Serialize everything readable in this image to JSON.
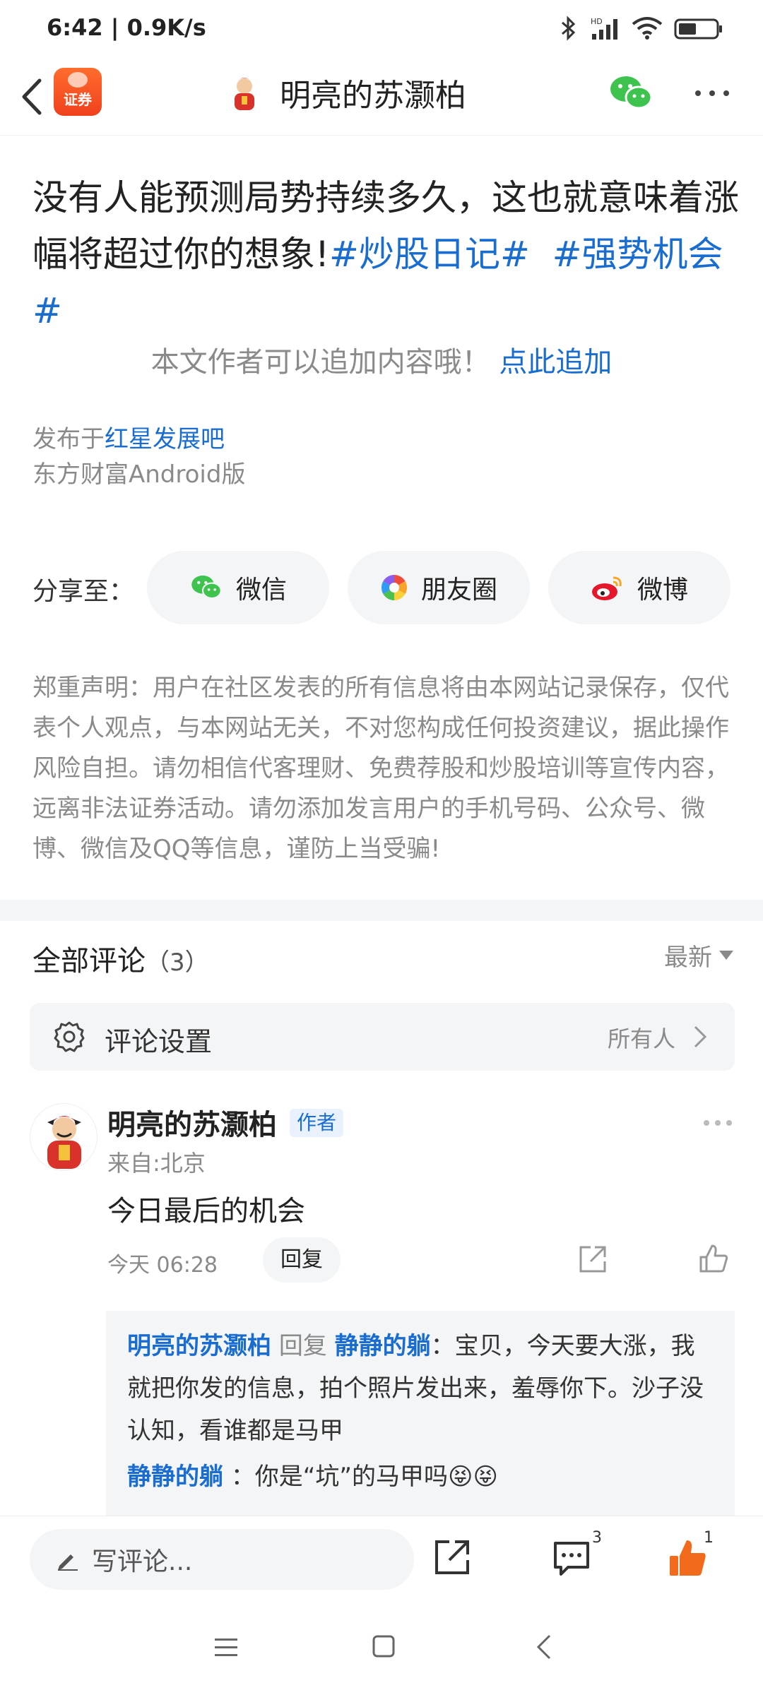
{
  "status_bar": {
    "time_speed": "6:42 | 0.9K/s",
    "icons": [
      "bluetooth-icon",
      "signal-hd-icon",
      "wifi-icon",
      "battery-icon"
    ]
  },
  "navbar": {
    "app_badge": "证券",
    "title": "明亮的苏灏柏",
    "icons": [
      "back-arrow-icon",
      "wechat-icon",
      "more-dots-icon"
    ]
  },
  "post": {
    "text_main": "没有人能预测局势持续多久，这也就意味着涨幅将超过你的想象!",
    "tag1": "#炒股日记#",
    "tag2": "#强势机会#",
    "append_prompt": "本文作者可以追加内容哦！",
    "append_link": "点此追加",
    "published_prefix": "发布于",
    "published_forum": "红星发展吧",
    "client": "东方财富Android版"
  },
  "share": {
    "label": "分享至：",
    "wechat": "微信",
    "moments": "朋友圈",
    "weibo": "微博"
  },
  "disclaimer": "郑重声明：用户在社区发表的所有信息将由本网站记录保存，仅代表个人观点，与本网站无关，不对您构成任何投资建议，据此操作风险自担。请勿相信代客理财、免费荐股和炒股培训等宣传内容，远离非法证券活动。请勿添加发言用户的手机号码、公众号、微博、微信及QQ等信息，谨防上当受骗!",
  "comments": {
    "title": "全部评论",
    "count": "（3）",
    "sort": "最新",
    "settings_label": "评论设置",
    "settings_value": "所有人"
  },
  "comment1": {
    "author": "明亮的苏灏柏",
    "badge": "作者",
    "location": "来自:北京",
    "text": "今日最后的机会",
    "time": "今天 06:28",
    "reply_button": "回复",
    "reply1_from": "明亮的苏灏柏",
    "reply1_verb": "回复",
    "reply1_to": "静静的躺",
    "reply1_text": "：宝贝，今天要大涨，我就把你发的信息，拍个照片发出来，羞辱你下。沙子没认知，看谁都是马甲",
    "reply2_from": "静静的躺",
    "reply2_text": "：你是“坑”的马甲吗😝😝"
  },
  "bottom_bar": {
    "write_placeholder": "写评论...",
    "comment_count": "3",
    "like_count": "1"
  },
  "colors": {
    "link_blue": "#1a6dd0",
    "like_orange": "#f26a1b",
    "muted_gray": "#8a8a8a"
  }
}
